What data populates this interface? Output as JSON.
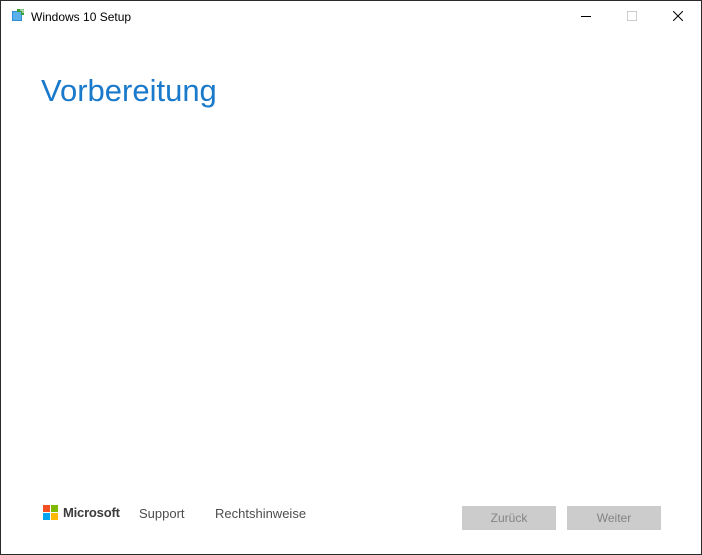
{
  "window": {
    "title": "Windows 10 Setup",
    "icon": "setup-icon",
    "controls": [
      "minimize-icon",
      "maximize-icon",
      "close-icon"
    ]
  },
  "main": {
    "heading": "Vorbereitung",
    "heading_color": "#1979ca"
  },
  "footer": {
    "brand": "Microsoft",
    "brand_colors": [
      "#f25022",
      "#7fba00",
      "#00a4ef",
      "#ffb900"
    ],
    "links": [
      "Support",
      "Rechtshinweise"
    ],
    "buttons": {
      "back_label": "Zurück",
      "next_label": "Weiter",
      "back_enabled": false,
      "next_enabled": false
    }
  }
}
